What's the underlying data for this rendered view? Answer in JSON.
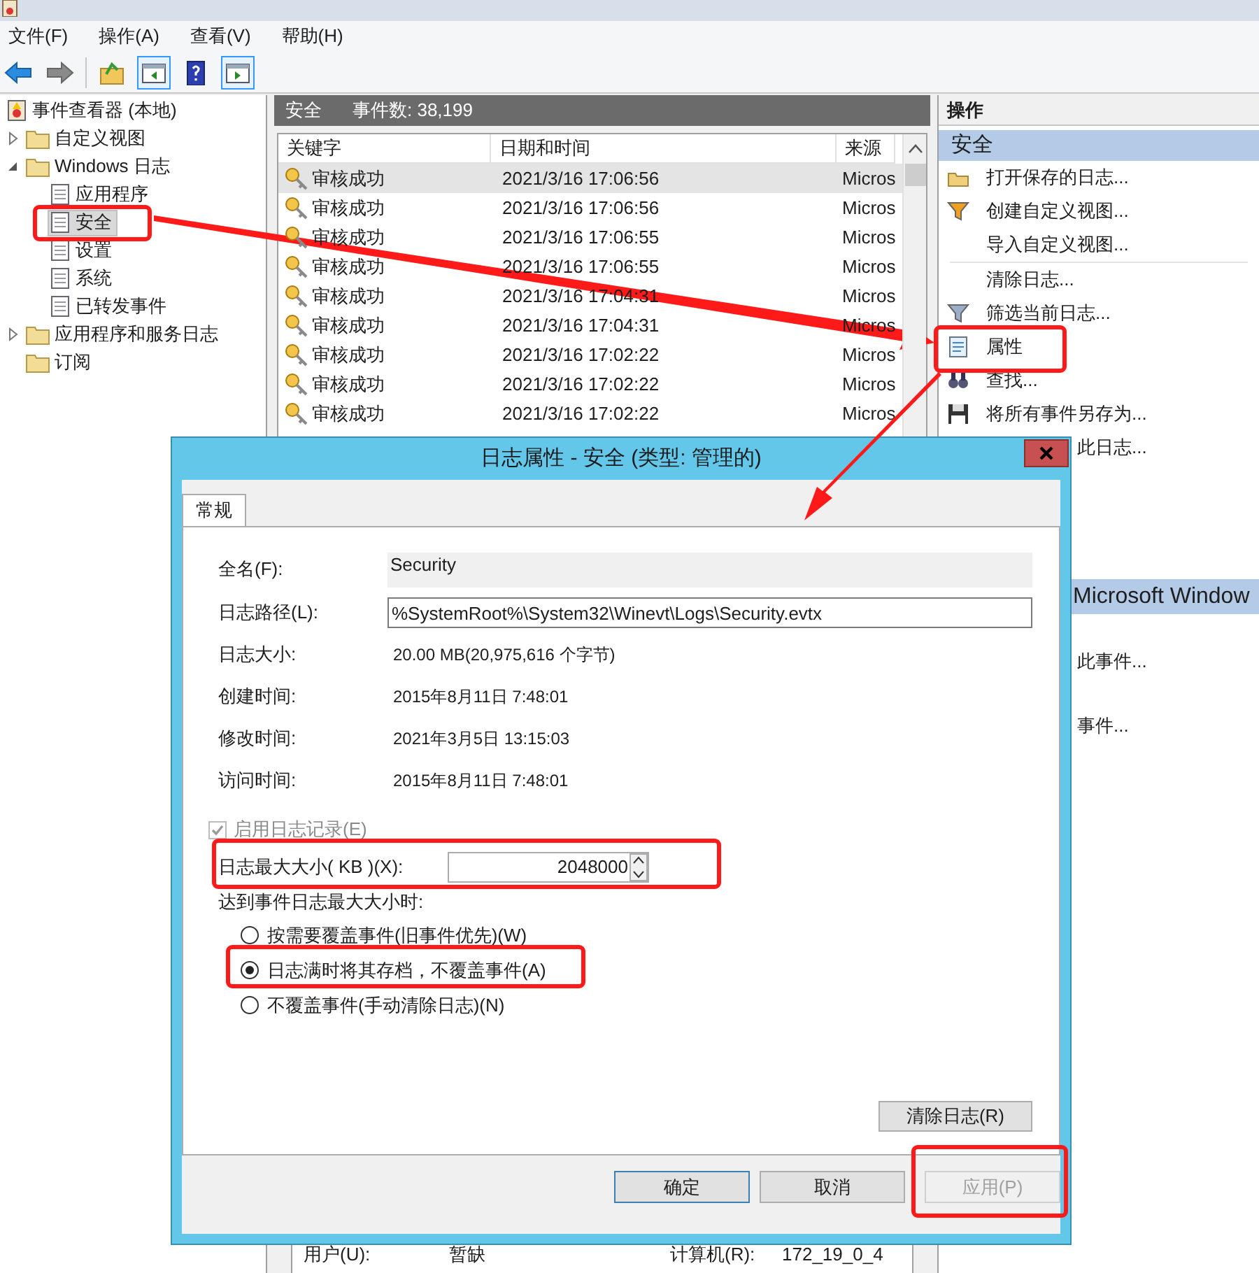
{
  "menu": [
    "文件(F)",
    "操作(A)",
    "查看(V)",
    "帮助(H)"
  ],
  "toolbar": [
    {
      "kind": "back",
      "pressed": false
    },
    {
      "kind": "forward",
      "pressed": false
    },
    {
      "kind": "up",
      "pressed": false
    },
    {
      "kind": "tree",
      "pressed": true
    },
    {
      "kind": "help",
      "pressed": false
    },
    {
      "kind": "actions",
      "pressed": true
    }
  ],
  "tree": [
    {
      "label": "事件查看器 (本地)",
      "selected": false,
      "children": [
        {
          "label": "自定义视图",
          "selected": false,
          "expanded": false
        },
        {
          "label": "Windows 日志",
          "selected": false,
          "expanded": true,
          "children": [
            {
              "label": "应用程序",
              "selected": false
            },
            {
              "label": "安全",
              "selected": true
            },
            {
              "label": "设置",
              "selected": false
            },
            {
              "label": "系统",
              "selected": false
            },
            {
              "label": "已转发事件",
              "selected": false
            }
          ]
        },
        {
          "label": "应用程序和服务日志",
          "selected": false,
          "expanded": false
        },
        {
          "label": "订阅",
          "selected": false
        }
      ]
    }
  ],
  "events": {
    "title": "安全",
    "count": "事件数: 38,199",
    "columns": [
      "关键字",
      "日期和时间",
      "来源"
    ],
    "rows": [
      {
        "keyword": "审核成功",
        "datetime": "2021/3/16 17:06:56",
        "source": "Micros",
        "selected": true
      },
      {
        "keyword": "审核成功",
        "datetime": "2021/3/16 17:06:56",
        "source": "Micros",
        "selected": false
      },
      {
        "keyword": "审核成功",
        "datetime": "2021/3/16 17:06:55",
        "source": "Micros",
        "selected": false
      },
      {
        "keyword": "审核成功",
        "datetime": "2021/3/16 17:06:55",
        "source": "Micros",
        "selected": false
      },
      {
        "keyword": "审核成功",
        "datetime": "2021/3/16 17:04:31",
        "source": "Micros",
        "selected": false
      },
      {
        "keyword": "审核成功",
        "datetime": "2021/3/16 17:04:31",
        "source": "Micros",
        "selected": false
      },
      {
        "keyword": "审核成功",
        "datetime": "2021/3/16 17:02:22",
        "source": "Micros",
        "selected": false
      },
      {
        "keyword": "审核成功",
        "datetime": "2021/3/16 17:02:22",
        "source": "Micros",
        "selected": false
      },
      {
        "keyword": "审核成功",
        "datetime": "2021/3/16 17:02:22",
        "source": "Micros",
        "selected": false
      }
    ],
    "details": [
      {
        "label": "用户(U):",
        "value": "暂缺"
      },
      {
        "label": "计算机(R):",
        "value": "172_19_0_4"
      }
    ]
  },
  "actions": {
    "title": "操作",
    "sections": [
      {
        "title": "安全",
        "items": [
          {
            "kind": "item",
            "label": "打开保存的日志..."
          },
          {
            "kind": "item",
            "label": "创建自定义视图..."
          },
          {
            "kind": "item",
            "label": "导入自定义视图..."
          },
          {
            "kind": "divider"
          },
          {
            "kind": "item",
            "label": "清除日志..."
          },
          {
            "kind": "item",
            "label": "筛选当前日志..."
          },
          {
            "kind": "item",
            "label": "属性"
          },
          {
            "kind": "item",
            "label": "查找..."
          },
          {
            "kind": "item",
            "label": "将所有事件另存为..."
          },
          {
            "kind": "cut",
            "label": "此日志..."
          }
        ]
      },
      {
        "title": "Microsoft Window",
        "items": [
          {
            "kind": "cut",
            "label": "此事件..."
          },
          {
            "kind": "cut",
            "label": "事件..."
          }
        ]
      }
    ]
  },
  "dialog": {
    "title": "日志属性 - 安全 (类型: 管理的)",
    "tabs": [
      {
        "label": "常规",
        "selected": true
      }
    ],
    "fields": [
      {
        "kind": "readonly",
        "label": "全名(F):",
        "value": "Security"
      },
      {
        "kind": "input",
        "label": "日志路径(L):",
        "value": "%SystemRoot%\\System32\\Winevt\\Logs\\Security.evtx"
      },
      {
        "kind": "text",
        "label": "日志大小:",
        "value": "20.00 MB(20,975,616 个字节)"
      },
      {
        "kind": "text",
        "label": "创建时间:",
        "value": "2015年8月11日 7:48:01"
      },
      {
        "kind": "text",
        "label": "修改时间:",
        "value": "2021年3月5日 13:15:03"
      },
      {
        "kind": "text",
        "label": "访问时间:",
        "value": "2015年8月11日 7:48:01"
      }
    ],
    "enable_logging": {
      "label": "启用日志记录(E)",
      "checked": true,
      "disabled": true
    },
    "max_size": {
      "label": "日志最大大小( KB )(X):",
      "value": "2048000"
    },
    "policy_label": "达到事件日志最大大小时:",
    "policies": [
      {
        "label": "按需要覆盖事件(旧事件优先)(W)",
        "selected": false
      },
      {
        "label": "日志满时将其存档，不覆盖事件(A)",
        "selected": true
      },
      {
        "label": "不覆盖事件(手动清除日志)(N)",
        "selected": false
      }
    ],
    "clear_button": "清除日志(R)",
    "buttons": [
      {
        "label": "确定",
        "default": true,
        "disabled": false
      },
      {
        "label": "取消",
        "default": false,
        "disabled": false
      },
      {
        "label": "应用(P)",
        "default": false,
        "disabled": true
      }
    ]
  }
}
